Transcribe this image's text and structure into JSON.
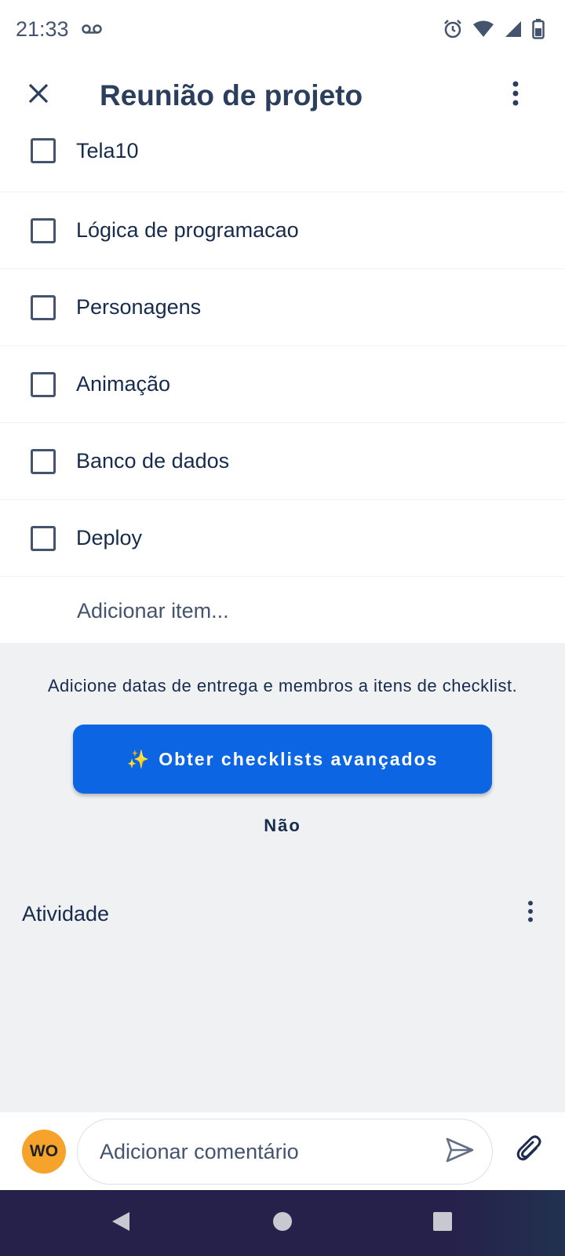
{
  "status_bar": {
    "time": "21:33",
    "icons": [
      "voicemail-icon",
      "alarm-icon",
      "wifi-icon",
      "signal-icon",
      "battery-icon"
    ]
  },
  "header": {
    "title": "Reunião de projeto",
    "close_icon": "close-icon",
    "more_icon": "more-vertical-icon"
  },
  "checklist": {
    "items": [
      {
        "label": "Tela10",
        "checked": false
      },
      {
        "label": "Lógica de programacao",
        "checked": false
      },
      {
        "label": "Personagens",
        "checked": false
      },
      {
        "label": "Animação",
        "checked": false
      },
      {
        "label": "Banco de dados",
        "checked": false
      },
      {
        "label": "Deploy",
        "checked": false
      }
    ],
    "add_item_placeholder": "Adicionar item..."
  },
  "promo": {
    "text": "Adicione datas de entrega e membros a itens de checklist.",
    "button_icon": "✨",
    "button_label": "Obter checklists avançados",
    "dismiss_label": "Não"
  },
  "activity": {
    "label": "Atividade"
  },
  "comment": {
    "avatar_initials": "WO",
    "placeholder": "Adicionar comentário"
  },
  "colors": {
    "accent": "#0c66e4",
    "avatar": "#f5a32a",
    "background_gray": "#f0f1f3",
    "nav_bar": "#26214b"
  }
}
